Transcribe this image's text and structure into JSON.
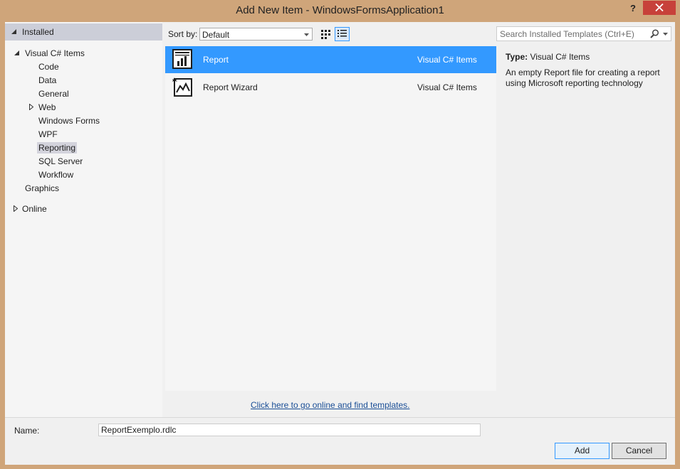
{
  "window": {
    "title": "Add New Item - WindowsFormsApplication1",
    "help_label": "?"
  },
  "tree": {
    "installed": "Installed",
    "visual_csharp": "Visual C# Items",
    "children": [
      "Code",
      "Data",
      "General",
      "Web",
      "Windows Forms",
      "WPF",
      "Reporting",
      "SQL Server",
      "Workflow"
    ],
    "selected": "Reporting",
    "graphics": "Graphics",
    "online": "Online"
  },
  "toolbar": {
    "sort_label": "Sort by:",
    "sort_value": "Default",
    "search_placeholder": "Search Installed Templates (Ctrl+E)"
  },
  "items": [
    {
      "name": "Report",
      "category": "Visual C# Items",
      "icon": "report-icon",
      "selected": true
    },
    {
      "name": "Report Wizard",
      "category": "Visual C# Items",
      "icon": "report-wizard-icon",
      "selected": false
    }
  ],
  "details": {
    "type_label": "Type:",
    "type_value": "Visual C# Items",
    "description": "An empty Report file for creating a report using Microsoft reporting technology"
  },
  "online_link": "Click here to go online and find templates.",
  "name_field": {
    "label": "Name:",
    "value": "ReportExemplo.rdlc"
  },
  "buttons": {
    "add": "Add",
    "cancel": "Cancel"
  },
  "colors": {
    "title_bar": "#cfa57a",
    "close_button": "#c7413a",
    "selection": "#3399ff",
    "link": "#1a4e96"
  }
}
